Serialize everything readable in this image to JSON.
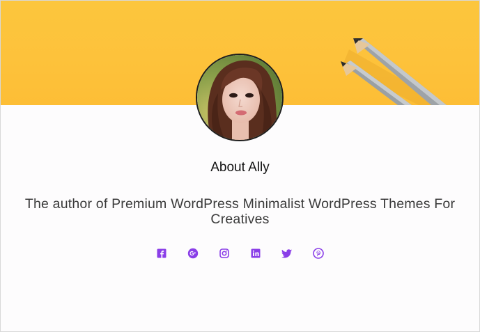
{
  "profile": {
    "title": "About Ally",
    "bio_line1": "The author of Premium WordPress Minimalist WordPress Themes For",
    "bio_line2": "Creatives"
  },
  "social": [
    {
      "network": "facebook",
      "icon": "facebook-icon"
    },
    {
      "network": "google-plus",
      "icon": "google-plus-icon"
    },
    {
      "network": "instagram",
      "icon": "instagram-icon"
    },
    {
      "network": "linkedin",
      "icon": "linkedin-icon"
    },
    {
      "network": "twitter",
      "icon": "twitter-icon"
    },
    {
      "network": "pinterest",
      "icon": "pinterest-icon"
    }
  ],
  "colors": {
    "accent": "#8a3ee8",
    "cover": "#fdc23b",
    "text": "#111111"
  }
}
